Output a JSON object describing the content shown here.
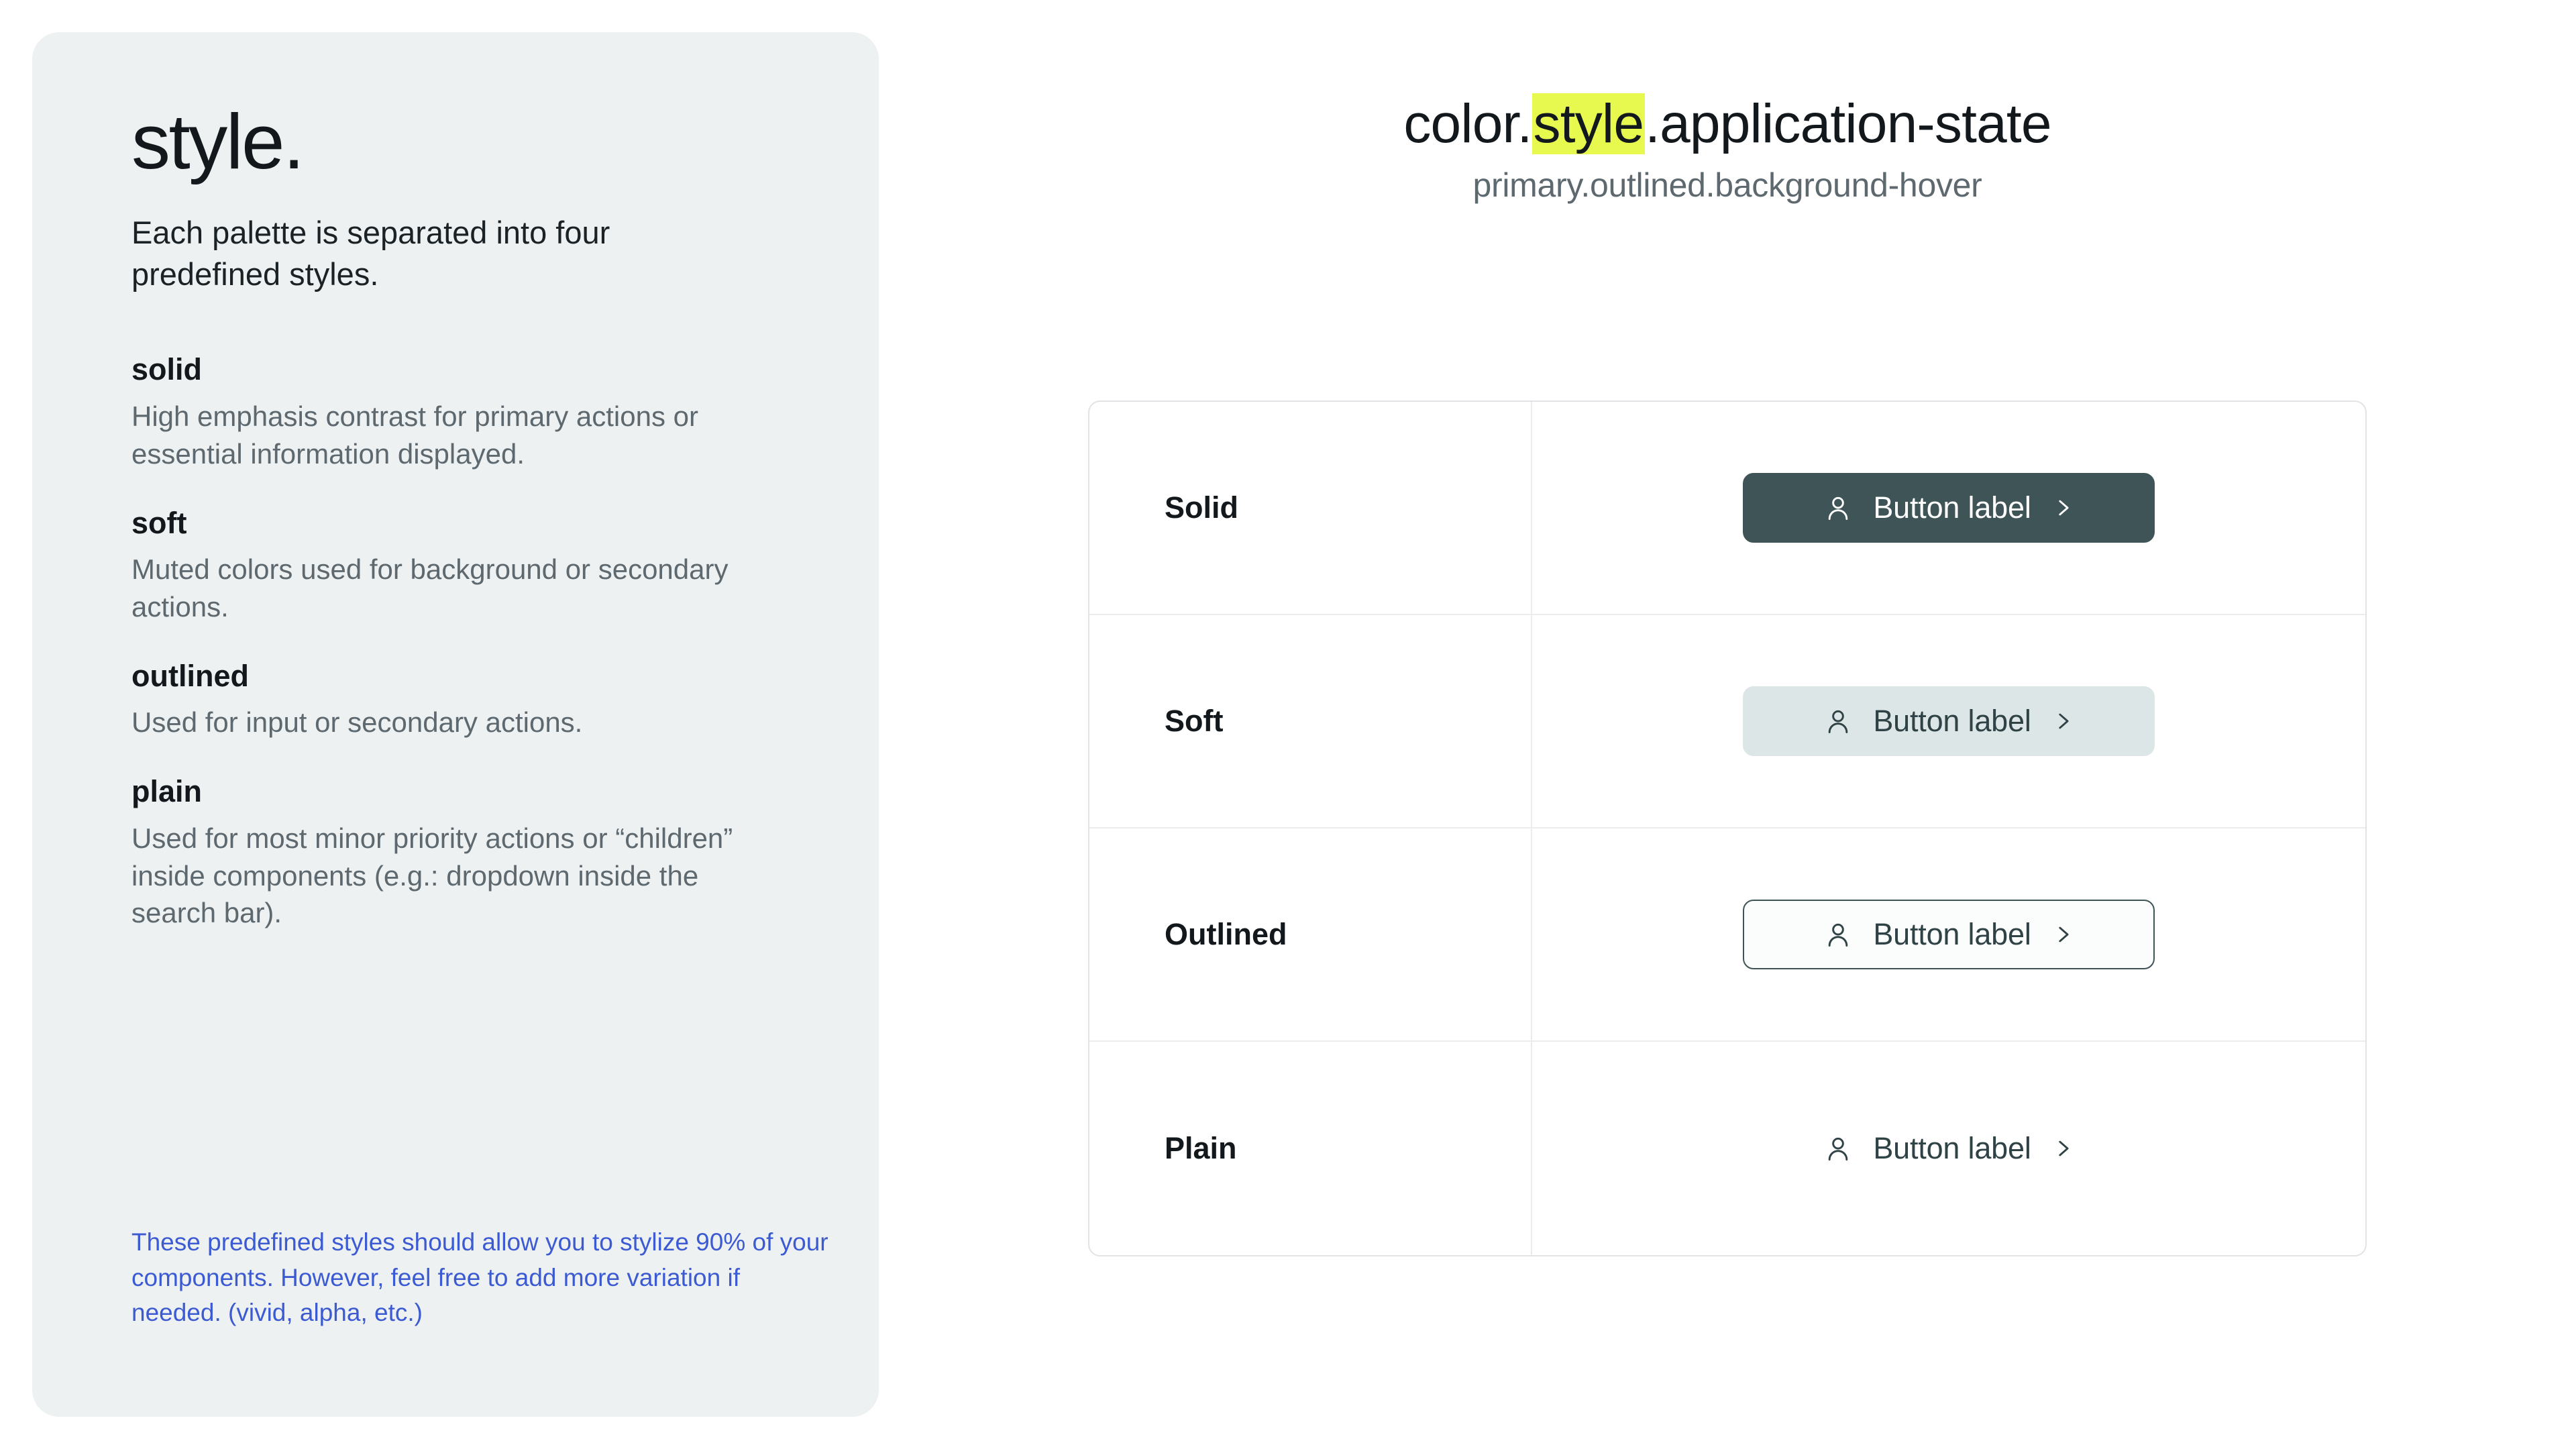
{
  "doc": {
    "title": "style.",
    "intro": "Each palette is separated into four predefined styles.",
    "styles": [
      {
        "name": "solid",
        "description": "High emphasis contrast for primary actions or essential information displayed."
      },
      {
        "name": "soft",
        "description": "Muted colors used for background or secondary actions."
      },
      {
        "name": "outlined",
        "description": "Used for input or secondary actions."
      },
      {
        "name": "plain",
        "description": "Used for most minor priority actions or “children” inside components (e.g.: dropdown inside the search bar)."
      }
    ],
    "footnote": "These predefined styles should allow you to stylize 90% of your components. However, feel free to add more variation if needed. (vivid, alpha, etc.)"
  },
  "header": {
    "title_prefix": "color.",
    "title_highlight": "style",
    "title_suffix": ".application-state",
    "subtitle": "primary.outlined.background-hover"
  },
  "table": {
    "rows": [
      {
        "label": "Solid",
        "button_label": "Button label",
        "leading_icon": "user-icon",
        "trailing_icon": "chevron-right-icon"
      },
      {
        "label": "Soft",
        "button_label": "Button label",
        "leading_icon": "user-icon",
        "trailing_icon": "chevron-right-icon"
      },
      {
        "label": "Outlined",
        "button_label": "Button label",
        "leading_icon": "user-icon",
        "trailing_icon": "chevron-right-icon"
      },
      {
        "label": "Plain",
        "button_label": "Button label",
        "leading_icon": "user-icon",
        "trailing_icon": "chevron-right-icon"
      }
    ]
  },
  "colors": {
    "card_background": "#eef1f1",
    "highlight": "#e7f94e",
    "footnote_text": "#3c5bd3",
    "solid_background": "#3e5457",
    "soft_background": "#dde6e6",
    "outlined_border": "#3e5457",
    "outlined_hover_background": "#fbfcfc",
    "muted_text": "#5d686f",
    "heading_text": "#13181c",
    "table_border": "#e2e3e7"
  }
}
